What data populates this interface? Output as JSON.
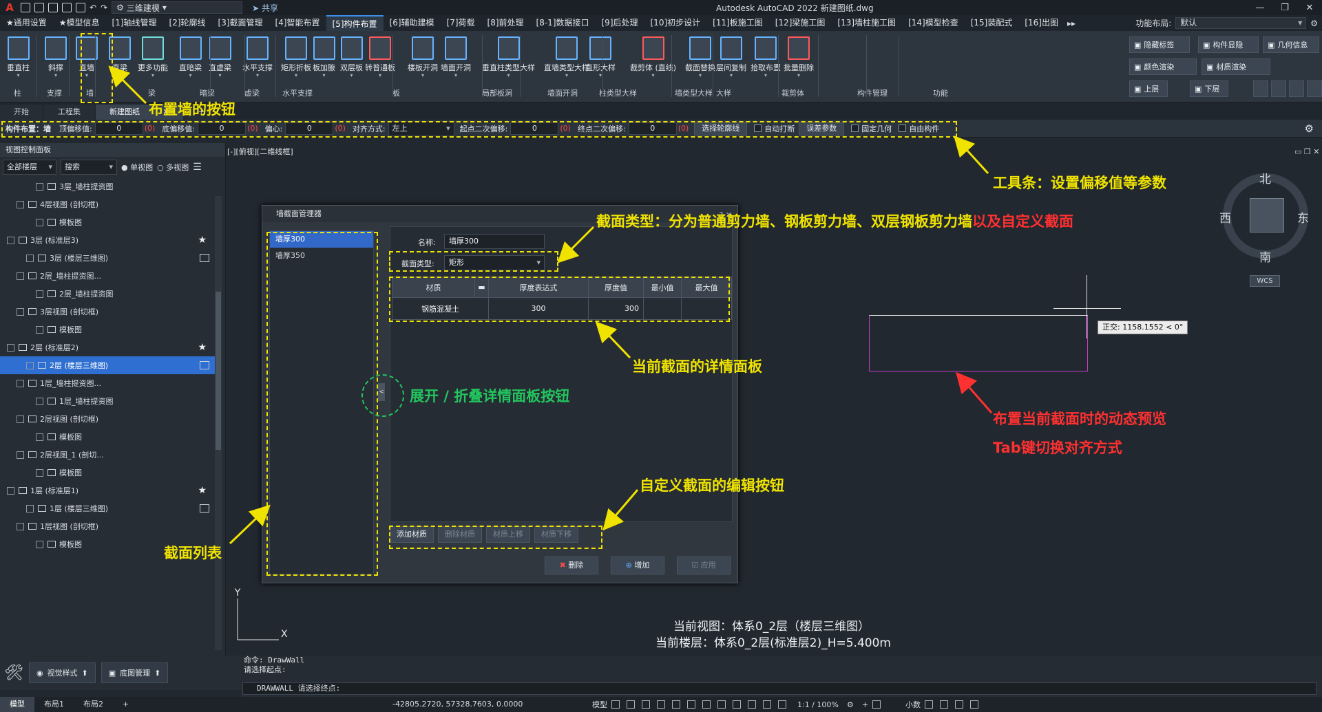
{
  "titlebar": {
    "app_logo": "A",
    "workspace": "三维建模",
    "share": "共享",
    "doc_title": "Autodesk AutoCAD 2022    新建图纸.dwg"
  },
  "menu_tabs": [
    "★通用设置",
    "★模型信息",
    "[1]轴线管理",
    "[2]轮廓线",
    "[3]截面管理",
    "[4]智能布置",
    "[5]构件布置",
    "[6]辅助建模",
    "[7]荷载",
    "[8]前处理",
    "[8-1]数据接口",
    "[9]后处理",
    "[10]初步设计",
    "[11]板施工图",
    "[12]梁施工图",
    "[13]墙柱施工图",
    "[14]模型检查",
    "[15]装配式",
    "[16]出图"
  ],
  "active_menu_tab": "[5]构件布置",
  "func_layout": {
    "label": "功能布局:",
    "value": "默认"
  },
  "ribbon": {
    "buttons": [
      "垂直柱",
      "斜撑",
      "直墙",
      "直梁",
      "更多功能",
      "直暗梁",
      "直虚梁",
      "水平支撑",
      "矩形折板",
      "板加腋",
      "双层板",
      "转普通板",
      "楼板开洞",
      "墙面开洞",
      "垂直柱类型大样",
      "直墙类型大样",
      "直形大样",
      "裁剪体 (直线)",
      "截面替换",
      "层间复制",
      "拾取布置",
      "批量删除"
    ],
    "groups": [
      "柱",
      "支撑",
      "墙",
      "梁",
      "暗梁",
      "虚梁",
      "水平支撑",
      "板",
      "局部板洞",
      "墙面开洞",
      "柱类型大样",
      "墙类型大样",
      "大样",
      "裁剪体",
      "构件管理",
      "功能"
    ],
    "right_buttons": [
      "隐藏标签",
      "构件显隐",
      "几何信息",
      "颜色渲染",
      "材质渲染",
      "上层",
      "下层"
    ]
  },
  "doc_tabs": [
    "开始",
    "工程集",
    "新建图纸"
  ],
  "toolbar": {
    "prefix": "构件布置：墙",
    "top_offset_label": "顶偏移值:",
    "top_offset": "0",
    "bottom_offset_label": "底偏移值:",
    "bottom_offset": "0",
    "eccentric_label": "偏心:",
    "eccentric": "0",
    "align_label": "对齐方式:",
    "align": "左上",
    "start_offset_label": "起点二次偏移:",
    "start_offset": "0",
    "end_offset_label": "终点二次偏移:",
    "end_offset": "0",
    "unit": "(0)",
    "select_contour": "选择轮廓线",
    "auto_break": "自动打断",
    "error_param": "误差参数",
    "fixed_geom": "固定几何",
    "free_comp": "自由构件"
  },
  "left_panel": {
    "title": "视图控制面板",
    "floor_select": "全部楼层",
    "search": "搜索",
    "single_view": "单视图",
    "multi_view": "多视图",
    "tree": [
      "3层_墙柱提资图",
      "4层视图 (剖切框)",
      "模板图",
      "3层 (标准层3)",
      "3层 (楼层三维图)",
      "2层_墙柱提资图...",
      "2层_墙柱提资图",
      "3层视图 (剖切框)",
      "模板图",
      "2层 (标准层2)",
      "2层 (楼层三维图)",
      "1层_墙柱提资图...",
      "1层_墙柱提资图",
      "2层视图 (剖切框)",
      "模板图",
      "2层视图_1 (剖切...",
      "模板图",
      "1层 (标准层1)",
      "1层 (楼层三维图)",
      "1层视图 (剖切框)",
      "模板图"
    ],
    "bottom": [
      "视觉样式",
      "底图管理"
    ]
  },
  "view_label": "[-][俯视][二维线框]",
  "dialog": {
    "title": "墙截面管理器",
    "sections": [
      "墙厚300",
      "墙厚350"
    ],
    "name_label": "名称:",
    "name": "墙厚300",
    "type_label": "截面类型:",
    "type": "矩形",
    "columns": [
      "材质",
      "厚度表达式",
      "厚度值",
      "最小值",
      "最大值"
    ],
    "rows": [
      {
        "material": "钢筋混凝土",
        "expr": "300",
        "value": "300",
        "min": "",
        "max": ""
      }
    ],
    "edit_buttons": [
      "添加材质",
      "删除材质",
      "材质上移",
      "材质下移"
    ],
    "actions": [
      "删除",
      "增加",
      "应用"
    ]
  },
  "annotations": {
    "wall_btn": "布置墙的按钮",
    "toolbar": "工具条：设置偏移值等参数",
    "section_type": "截面类型：分为普通剪力墙、钢板剪力墙、双层钢板剪力墙",
    "section_type_red": "以及自定义截面",
    "detail": "当前截面的详情面板",
    "collapse": "展开 / 折叠详情面板按钮",
    "custom_edit": "自定义截面的编辑按钮",
    "section_list": "截面列表",
    "preview1": "布置当前截面时的动态预览",
    "preview2": "Tab键切换对齐方式"
  },
  "compass": {
    "n": "北",
    "s": "南",
    "e": "东",
    "w": "西",
    "wcs": "WCS"
  },
  "ortho_tip": "正交: 1158.1552 < 0°",
  "current_view": "当前视图：体系0_2层（楼层三维图）",
  "current_floor": "当前楼层：体系0_2层(标准层2)_H=5.400m",
  "command": {
    "line1": "命令: DrawWall",
    "line2": "请选择起点:",
    "input": "DRAWWALL 请选择终点:"
  },
  "status": {
    "layouts": [
      "模型",
      "布局1",
      "布局2"
    ],
    "coords": "-42805.2720, 57328.7603, 0.0000",
    "model": "模型",
    "scale": "1:1 / 100%",
    "decimal": "小数"
  }
}
